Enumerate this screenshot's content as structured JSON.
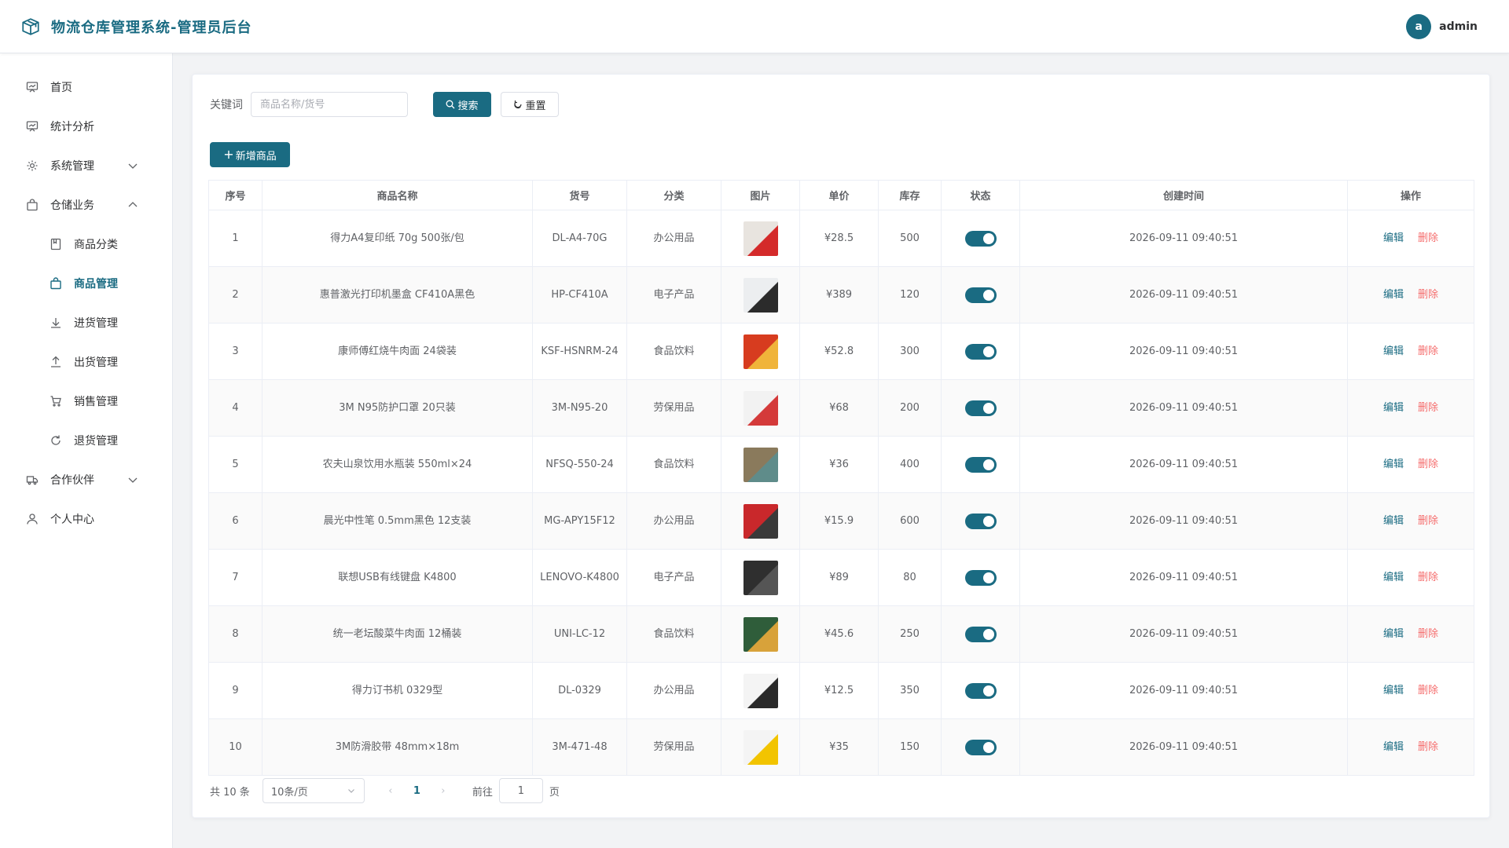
{
  "header": {
    "title": "物流仓库管理系统-管理员后台",
    "logo_icon": "package-box-icon",
    "user": {
      "avatar_letter": "a",
      "name": "admin"
    }
  },
  "sidebar": {
    "items": [
      {
        "label": "首页",
        "icon": "dashboard-icon"
      },
      {
        "label": "统计分析",
        "icon": "chart-icon"
      },
      {
        "label": "系统管理",
        "icon": "gear-icon",
        "expandable": true,
        "expanded": false
      },
      {
        "label": "仓储业务",
        "icon": "bag-icon",
        "expandable": true,
        "expanded": true
      },
      {
        "label": "商品分类",
        "icon": "notebook-icon",
        "sub": true
      },
      {
        "label": "商品管理",
        "icon": "bag-icon",
        "sub": true,
        "active": true
      },
      {
        "label": "进货管理",
        "icon": "download-icon",
        "sub": true
      },
      {
        "label": "出货管理",
        "icon": "upload-icon",
        "sub": true
      },
      {
        "label": "销售管理",
        "icon": "cart-icon",
        "sub": true
      },
      {
        "label": "退货管理",
        "icon": "refresh-icon",
        "sub": true
      },
      {
        "label": "合作伙伴",
        "icon": "truck-icon",
        "expandable": true,
        "expanded": false
      },
      {
        "label": "个人中心",
        "icon": "user-icon"
      }
    ]
  },
  "search": {
    "label": "关键词",
    "placeholder": "商品名称/货号",
    "value": "",
    "search_button": "搜索",
    "reset_button": "重置"
  },
  "toolbar": {
    "add_button": "新增商品"
  },
  "table": {
    "columns": [
      "序号",
      "商品名称",
      "货号",
      "分类",
      "图片",
      "单价",
      "库存",
      "状态",
      "创建时间",
      "操作"
    ],
    "edit_label": "编辑",
    "delete_label": "删除",
    "rows": [
      {
        "index": "1",
        "name": "得力A4复印纸 70g 500张/包",
        "sku": "DL-A4-70G",
        "category": "办公用品",
        "price": "¥28.5",
        "stock": "500",
        "enabled": true,
        "created": "2026-09-11 09:40:51",
        "thumb_color": "#e8e4df",
        "thumb_accent": "#d42a2a"
      },
      {
        "index": "2",
        "name": "惠普激光打印机墨盒 CF410A黑色",
        "sku": "HP-CF410A",
        "category": "电子产品",
        "price": "¥389",
        "stock": "120",
        "enabled": true,
        "created": "2026-09-11 09:40:51",
        "thumb_color": "#eceef0",
        "thumb_accent": "#2b2b2b"
      },
      {
        "index": "3",
        "name": "康师傅红烧牛肉面 24袋装",
        "sku": "KSF-HSNRM-24",
        "category": "食品饮料",
        "price": "¥52.8",
        "stock": "300",
        "enabled": true,
        "created": "2026-09-11 09:40:51",
        "thumb_color": "#d73c1f",
        "thumb_accent": "#f0b43a"
      },
      {
        "index": "4",
        "name": "3M N95防护口罩 20只装",
        "sku": "3M-N95-20",
        "category": "劳保用品",
        "price": "¥68",
        "stock": "200",
        "enabled": true,
        "created": "2026-09-11 09:40:51",
        "thumb_color": "#f2f2f2",
        "thumb_accent": "#d43a3a"
      },
      {
        "index": "5",
        "name": "农夫山泉饮用水瓶装 550ml×24",
        "sku": "NFSQ-550-24",
        "category": "食品饮料",
        "price": "¥36",
        "stock": "400",
        "enabled": true,
        "created": "2026-09-11 09:40:51",
        "thumb_color": "#8a7a5c",
        "thumb_accent": "#5f8c8a"
      },
      {
        "index": "6",
        "name": "晨光中性笔 0.5mm黑色 12支装",
        "sku": "MG-APY15F12",
        "category": "办公用品",
        "price": "¥15.9",
        "stock": "600",
        "enabled": true,
        "created": "2026-09-11 09:40:51",
        "thumb_color": "#c9282b",
        "thumb_accent": "#3a3a3a"
      },
      {
        "index": "7",
        "name": "联想USB有线键盘 K4800",
        "sku": "LENOVO-K4800",
        "category": "电子产品",
        "price": "¥89",
        "stock": "80",
        "enabled": true,
        "created": "2026-09-11 09:40:51",
        "thumb_color": "#2f2f2f",
        "thumb_accent": "#555555"
      },
      {
        "index": "8",
        "name": "统一老坛酸菜牛肉面 12桶装",
        "sku": "UNI-LC-12",
        "category": "食品饮料",
        "price": "¥45.6",
        "stock": "250",
        "enabled": true,
        "created": "2026-09-11 09:40:51",
        "thumb_color": "#2f5d3a",
        "thumb_accent": "#d8a23a"
      },
      {
        "index": "9",
        "name": "得力订书机 0329型",
        "sku": "DL-0329",
        "category": "办公用品",
        "price": "¥12.5",
        "stock": "350",
        "enabled": true,
        "created": "2026-09-11 09:40:51",
        "thumb_color": "#f4f4f4",
        "thumb_accent": "#2a2a2a"
      },
      {
        "index": "10",
        "name": "3M防滑胶带 48mm×18m",
        "sku": "3M-471-48",
        "category": "劳保用品",
        "price": "¥35",
        "stock": "150",
        "enabled": true,
        "created": "2026-09-11 09:40:51",
        "thumb_color": "#f4f4f4",
        "thumb_accent": "#f2c400"
      }
    ]
  },
  "pagination": {
    "total_text": "共 10 条",
    "page_size": "10条/页",
    "current_page": "1",
    "goto_label": "前往",
    "goto_value": "1",
    "goto_suffix": "页"
  },
  "colors": {
    "primary": "#1a6b82",
    "danger": "#f56c6c"
  }
}
